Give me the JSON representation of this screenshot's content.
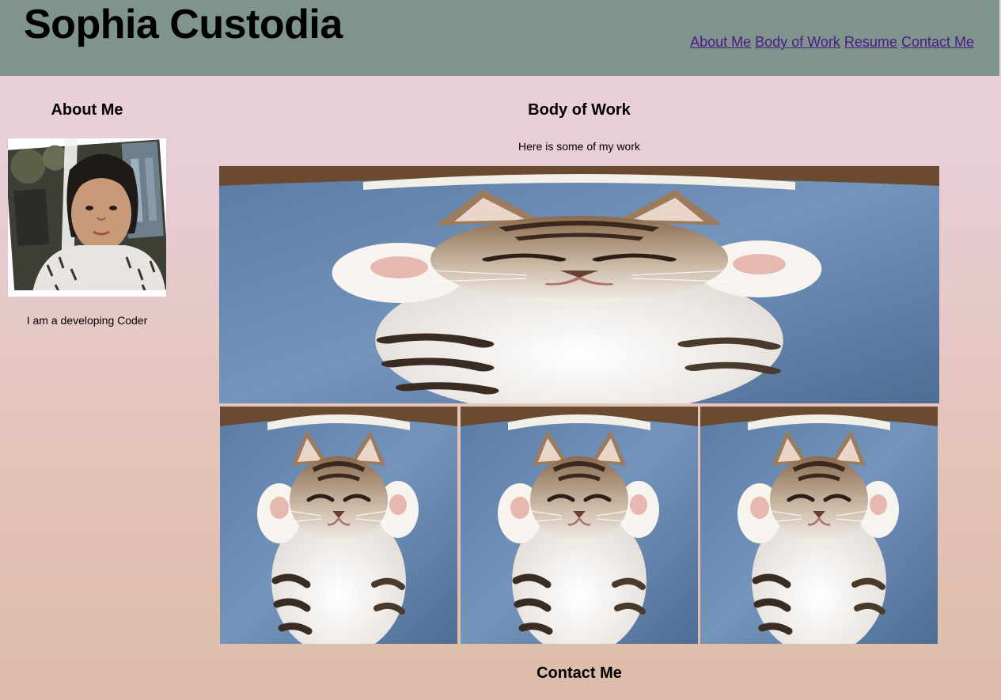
{
  "header": {
    "title": "Sophia Custodia",
    "nav": [
      {
        "label": "About Me"
      },
      {
        "label": "Body of Work"
      },
      {
        "label": "Resume"
      },
      {
        "label": "Contact Me"
      }
    ]
  },
  "sidebar": {
    "heading": "About Me",
    "photo_icon": "profile-photo",
    "text": "I am a developing Coder"
  },
  "main": {
    "heading": "Body of Work",
    "subtext": "Here is some of my work",
    "hero_icon": "kitten-photo",
    "thumbnails": [
      {
        "icon": "kitten-photo"
      },
      {
        "icon": "kitten-photo"
      },
      {
        "icon": "kitten-photo"
      }
    ]
  },
  "contact": {
    "heading": "Contact Me"
  },
  "colors": {
    "header_bg": "#7f948c",
    "link": "#4b1a86",
    "bg_top": "#e9d2e0",
    "bg_bottom": "#dcbca8"
  }
}
